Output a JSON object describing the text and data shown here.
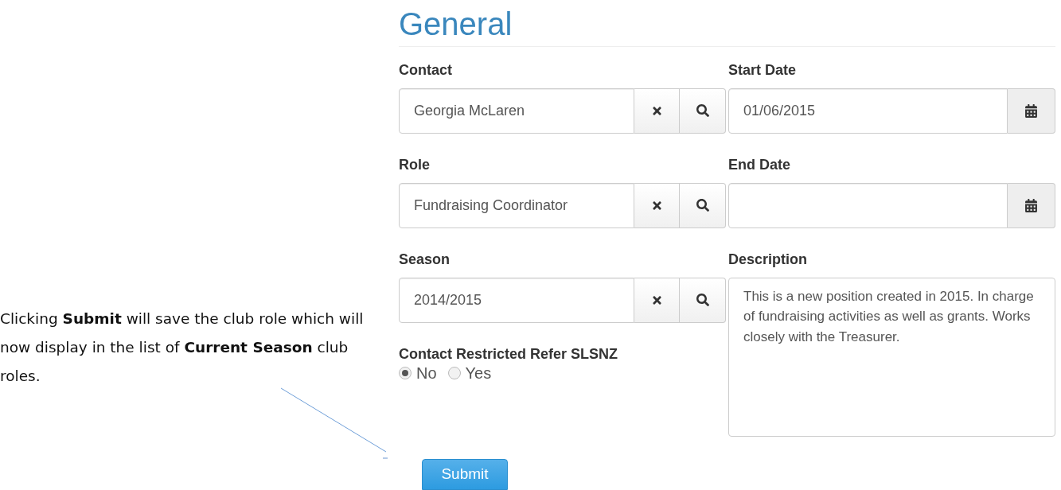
{
  "annotation": {
    "text": "Clicking **Submit** will save the club role which will now display in the list of **Current Season** club roles."
  },
  "form": {
    "heading": "General",
    "left_column": [
      {
        "kind": "lookup",
        "label": "Contact",
        "value": "Georgia McLaren"
      },
      {
        "kind": "lookup",
        "label": "Role",
        "value": "Fundraising Coordinator"
      },
      {
        "kind": "lookup",
        "label": "Season",
        "value": "2014/2015"
      },
      {
        "kind": "radio",
        "label": "Contact Restricted Refer SLSNZ",
        "options": [
          {
            "label": "No",
            "selected": true
          },
          {
            "label": "Yes",
            "selected": false
          }
        ]
      }
    ],
    "right_column": [
      {
        "kind": "date",
        "label": "Start Date",
        "value": "01/06/2015"
      },
      {
        "kind": "date",
        "label": "End Date"
      },
      {
        "kind": "textarea",
        "label": "Description",
        "value": "This is a new position created in 2015. In charge of fundraising activities as well as grants. Works closely with the Treasurer."
      }
    ],
    "submit": "Submit"
  }
}
